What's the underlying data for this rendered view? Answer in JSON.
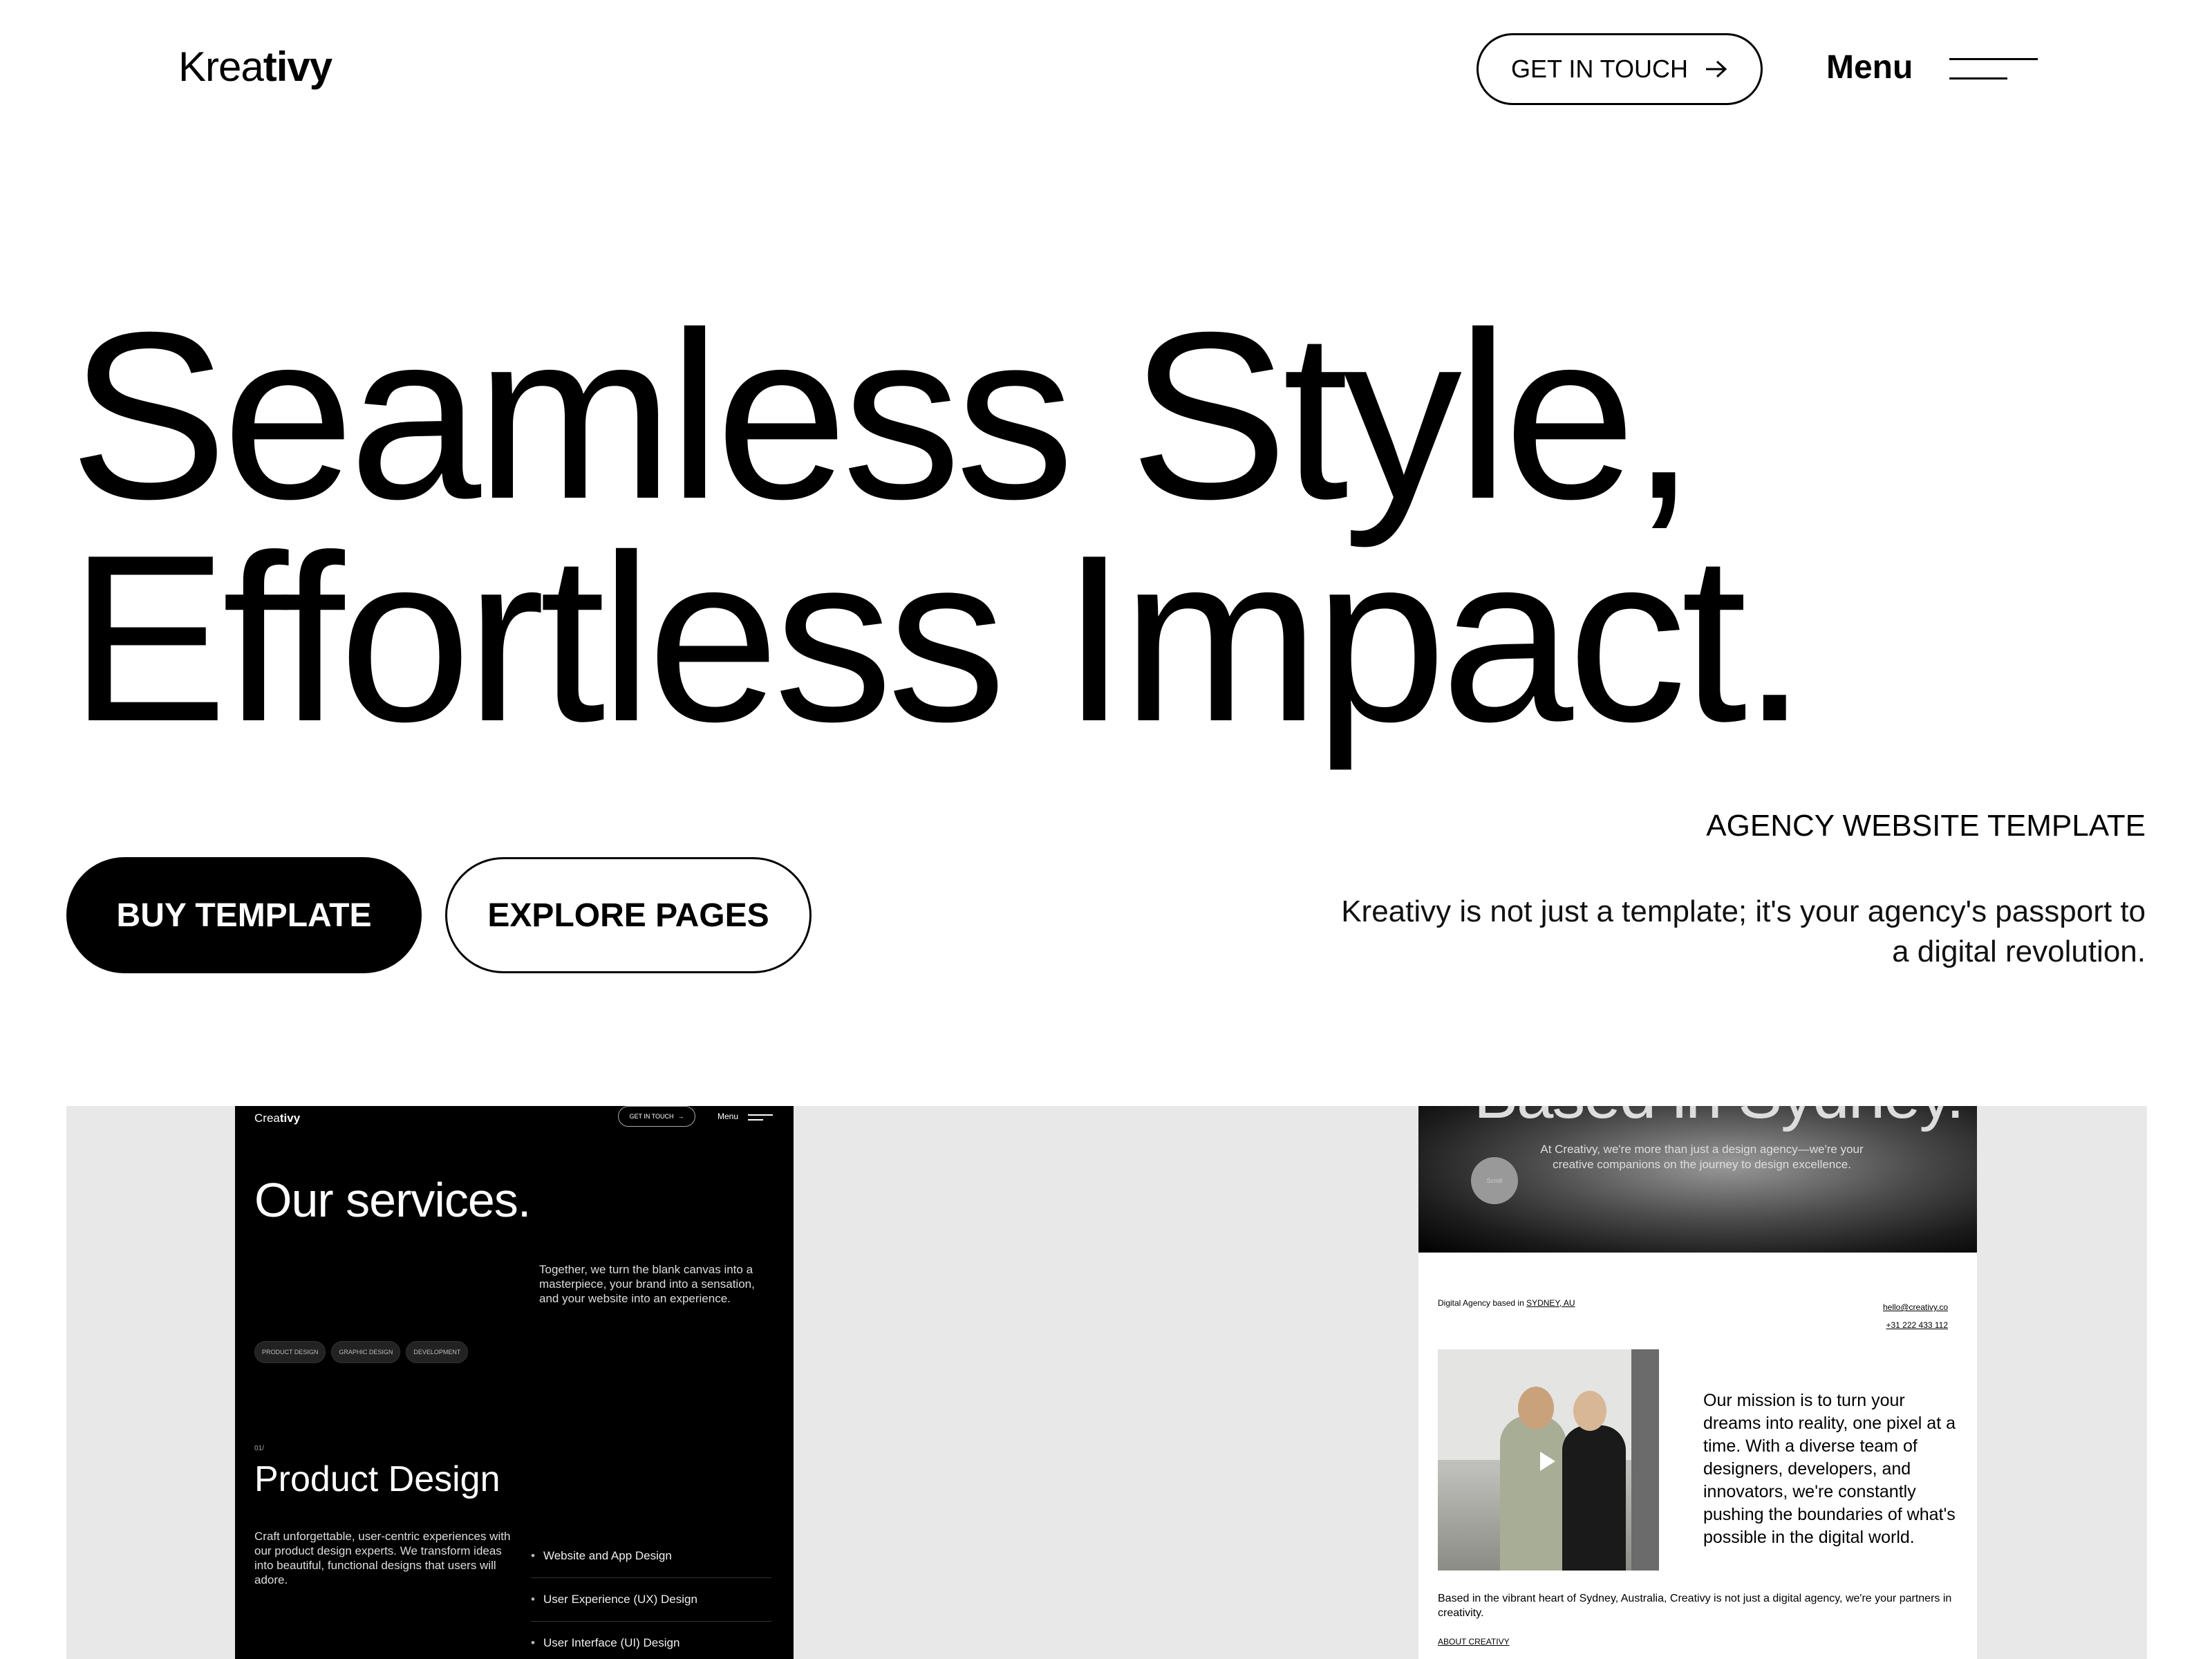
{
  "header": {
    "logo_light": "Krea",
    "logo_bold": "tivy",
    "contact_label": "GET IN TOUCH",
    "menu_label": "Menu"
  },
  "hero": {
    "title_line1": "Seamless Style,",
    "title_line2": "Effortless Impact.",
    "buy_label": "BUY TEMPLATE",
    "explore_label": "EXPLORE PAGES",
    "kicker": "AGENCY WEBSITE TEMPLATE",
    "tagline": "Kreativy is not just a template; it's your agency's passport to a digital revolution."
  },
  "preview_dark": {
    "logo_light": "Crea",
    "logo_bold": "tivy",
    "contact_label": "GET IN TOUCH",
    "menu_label": "Menu",
    "title": "Our services.",
    "description": "Together, we turn the blank canvas into a masterpiece, your brand into a sensation, and your website into an experience.",
    "tags": [
      "PRODUCT DESIGN",
      "GRAPHIC DESIGN",
      "DEVELOPMENT"
    ],
    "section_number": "01/",
    "section_title": "Product Design",
    "section_text": "Craft unforgettable, user-centric experiences with our product design experts. We transform ideas into beautiful, functional designs that users will adore.",
    "list": [
      "Website and App Design",
      "User Experience (UX) Design",
      "User Interface (UI) Design"
    ]
  },
  "preview_light": {
    "hero_clip_text": "Based in Sydney.",
    "hero_text": "At Creativy, we're more than just a design agency—we're your creative companions on the journey to design excellence.",
    "circle_label": "Scroll",
    "based_prefix": "Digital Agency based in",
    "based_location": "SYDNEY, AU",
    "email": "hello@creativy.co",
    "phone": "+31 222 433 112",
    "mission": "Our mission is to turn your dreams into reality, one pixel at a time. With a diverse team of designers, developers, and innovators, we're constantly pushing the boundaries of what's possible in the digital world.",
    "based_paragraph": "Based in the vibrant heart of Sydney, Australia, Creativy is not just a digital agency, we're your partners in creativity.",
    "about_link": "ABOUT CREATIVY"
  },
  "colors": {
    "accent": "#000000",
    "background": "#ffffff",
    "preview_bg": "#e8e8e8"
  }
}
